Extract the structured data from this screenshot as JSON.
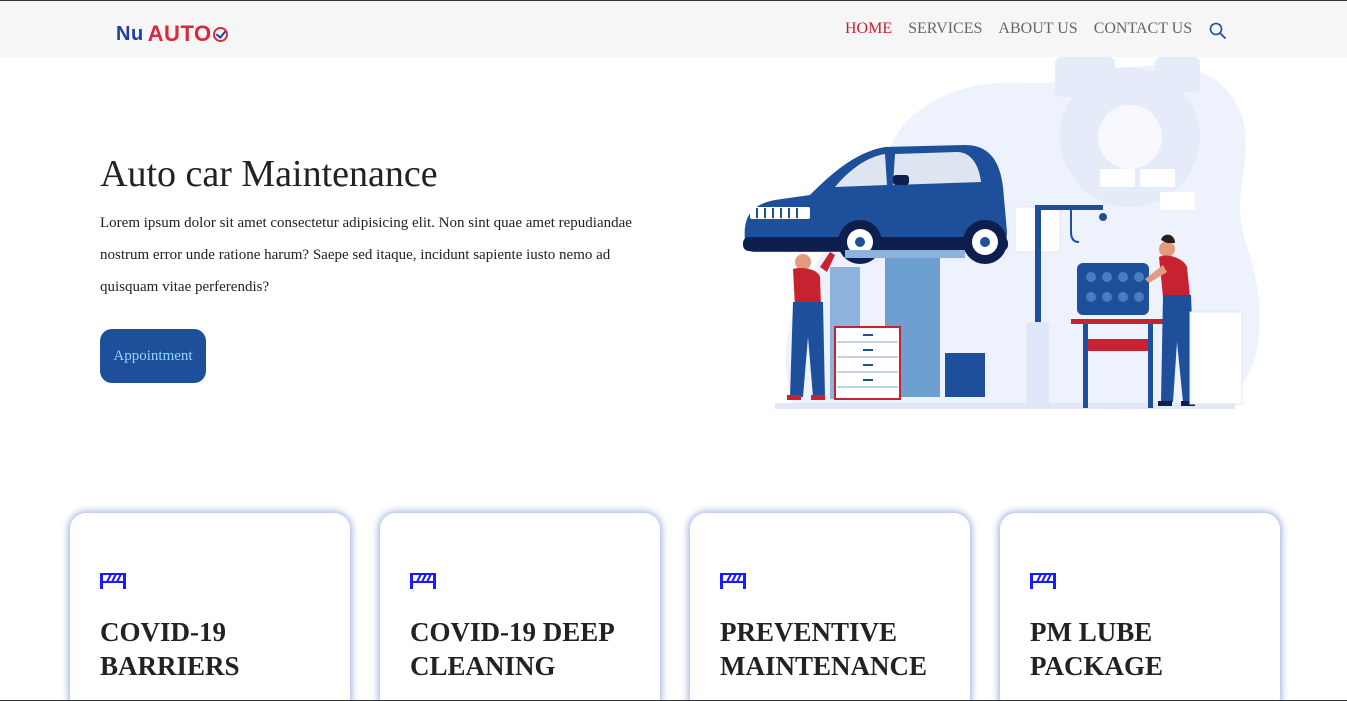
{
  "brand": {
    "name_part1": "Nu",
    "name_part2": "AUTO"
  },
  "nav": {
    "links": [
      {
        "label": "HOME",
        "active": true
      },
      {
        "label": "SERVICES",
        "active": false
      },
      {
        "label": "ABOUT US",
        "active": false
      },
      {
        "label": "CONTACT US",
        "active": false
      }
    ],
    "search_icon": "search-icon"
  },
  "hero": {
    "title": "Auto car Maintenance",
    "text": "Lorem ipsum dolor sit amet consectetur adipisicing elit. Non sint quae amet repudiandae nostrum error unde ratione harum? Saepe sed itaque, incidunt sapiente iusto nemo ad quisquam vitae perferendis?",
    "button_label": "Appointment"
  },
  "cards": [
    {
      "title": "COVID-19 BARRIERS",
      "icon": "barrier-icon"
    },
    {
      "title": "COVID-19 DEEP CLEANING",
      "icon": "barrier-icon"
    },
    {
      "title": "PREVENTIVE MAINTENANCE",
      "icon": "barrier-icon"
    },
    {
      "title": "PM LUBE PACKAGE",
      "icon": "barrier-icon"
    }
  ],
  "colors": {
    "accent": "#c6222f",
    "primary": "#1d4f9b",
    "button_text": "#8fd5ff",
    "icon_blue": "#1a1aff",
    "logo_blue": "#1f3f9a",
    "logo_red": "#d62b3c"
  }
}
